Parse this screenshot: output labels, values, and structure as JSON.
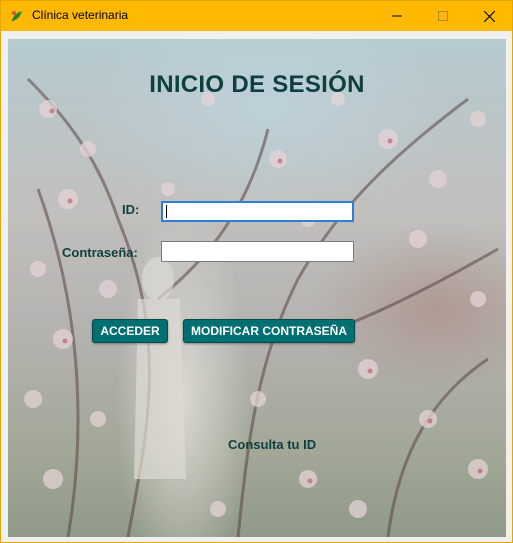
{
  "window": {
    "title": "Clínica veterinaria",
    "app_icon": "leaf-icon",
    "controls": [
      "minimize-icon",
      "maximize-icon",
      "close-icon"
    ],
    "titlebar_color": "#ffb900"
  },
  "form": {
    "heading": "INICIO DE SESIÓN",
    "id_label": "ID:",
    "id_value": "",
    "password_label": "Contraseña:",
    "password_value": "",
    "accept_button": "ACCEDER",
    "modify_button": "MODIFICAR CONTRASEÑA",
    "consult_link": "Consulta tu ID",
    "accent_color": "#006f72"
  }
}
